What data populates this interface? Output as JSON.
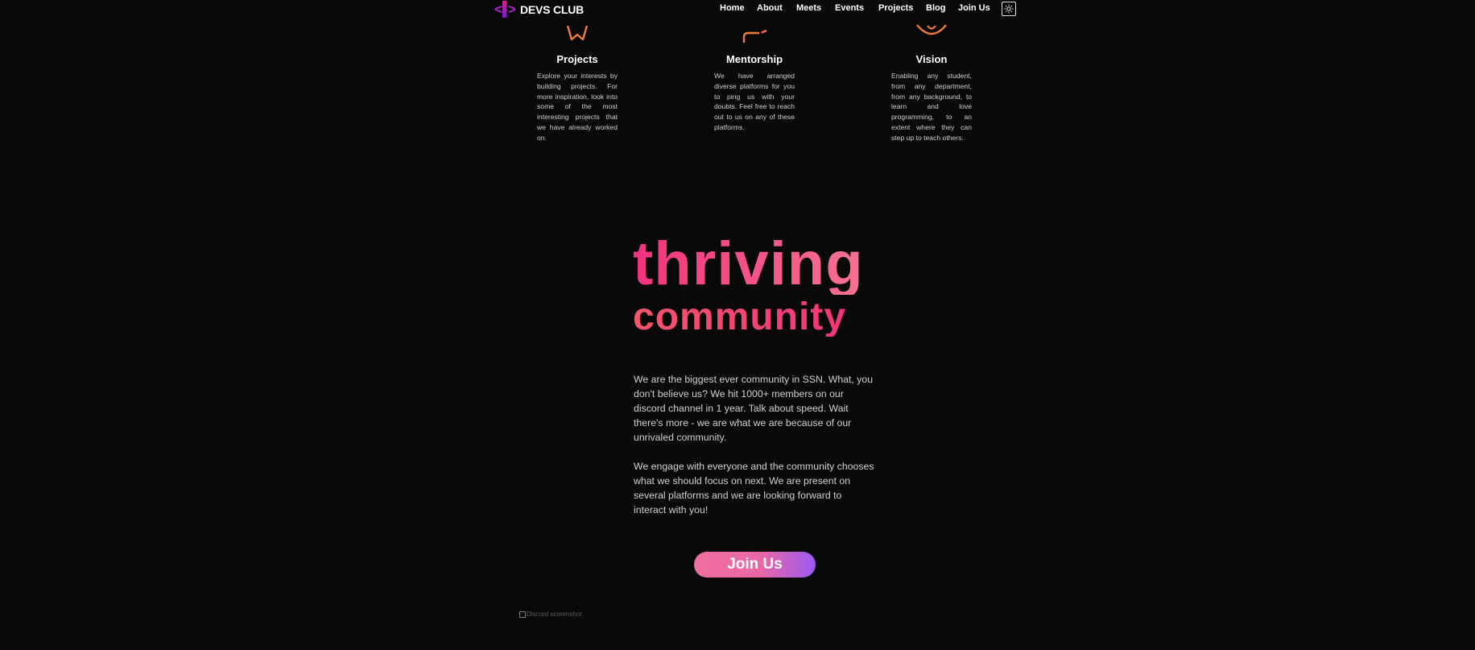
{
  "nav": {
    "brand": "DEVS CLUB",
    "links": [
      "Home",
      "About",
      "Meets",
      "Events",
      "Projects",
      "Blog",
      "Join Us"
    ],
    "theme_toggle_icon": "sun-icon"
  },
  "features": [
    {
      "icon": "star-icon",
      "title": "Projects",
      "text": "Explore your interests by building projects. For more inspiration, look into some of the most interesting projects that we have already worked on."
    },
    {
      "icon": "chat-icon",
      "title": "Mentorship",
      "text": "We have arranged diverse platforms for you to ping us with your doubts. Feel free to reach out to us on any of these platforms."
    },
    {
      "icon": "eye-icon",
      "title": "Vision",
      "text": "Enabling any student, from any department, from any background, to learn and love programming, to an extent where they can step up to teach others."
    }
  ],
  "hero": {
    "line1": "thriving",
    "line2": "community",
    "paragraph1": "We are the biggest ever community in SSN. What, you don't believe us? We hit 1000+ members on our discord channel in 1 year. Talk about speed. Wait there's more - we are what we are because of our unrivaled community.",
    "paragraph2": "We engage with everyone and the community chooses what we should focus on next. We are present on several platforms and we are looking forward to interact with you!",
    "cta": "Join Us",
    "image_alt": "Discord screenshot"
  },
  "colors": {
    "background": "#0a0909",
    "accent_pink": "#f2486f",
    "icon_orange": "#f07a3a"
  }
}
